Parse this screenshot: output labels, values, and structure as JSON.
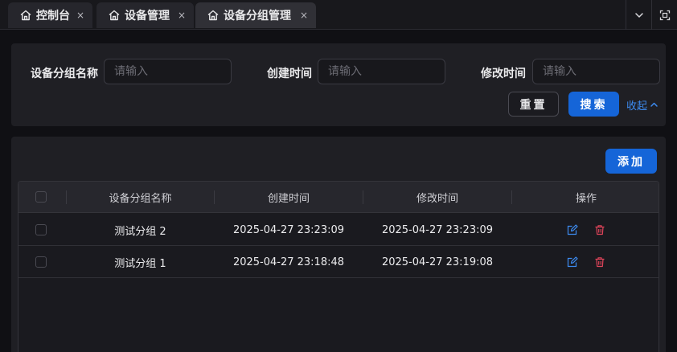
{
  "tabs": [
    {
      "label": "控制台",
      "icon": "home-icon",
      "close": "×"
    },
    {
      "label": "设备管理",
      "icon": "home-icon",
      "close": "×"
    },
    {
      "label": "设备分组管理",
      "icon": "home-icon",
      "close": "×"
    }
  ],
  "active_tab": 2,
  "toolbar_icons": [
    "chevron-down-icon",
    "fullscreen-icon"
  ],
  "search": {
    "fields": [
      {
        "label": "设备分组名称",
        "placeholder": "请输入"
      },
      {
        "label": "创建时间",
        "placeholder": "请输入"
      },
      {
        "label": "修改时间",
        "placeholder": "请输入"
      }
    ],
    "reset_label": "重置",
    "search_label": "搜索",
    "collapse_label": "收起"
  },
  "add_label": "添加",
  "table": {
    "columns": [
      "设备分组名称",
      "创建时间",
      "修改时间",
      "操作"
    ],
    "rows": [
      {
        "name": "测试分组 2",
        "created": "2025-04-27 23:23:09",
        "modified": "2025-04-27 23:23:09"
      },
      {
        "name": "测试分组 1",
        "created": "2025-04-27 23:18:48",
        "modified": "2025-04-27 23:19:08"
      }
    ],
    "action_icons": [
      "edit-icon",
      "delete-icon"
    ]
  },
  "colors": {
    "accent": "#1565d8",
    "link": "#3d8bf0",
    "danger": "#e0445a",
    "background": "#101014",
    "panel": "#1f1f24"
  }
}
